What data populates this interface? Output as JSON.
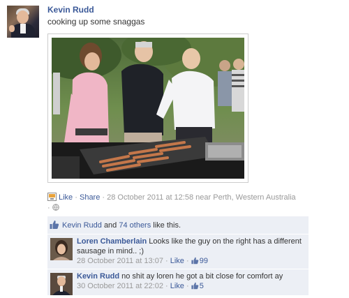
{
  "post": {
    "author": "Kevin Rudd",
    "status_text": "cooking up some snaggas",
    "photo_alt": "photo",
    "meta": {
      "like_label": "Like",
      "share_label": "Share",
      "timestamp": "28 October 2011 at 12:58",
      "location_prefix": "near",
      "location": "Perth, Western Australia",
      "separator": "·",
      "privacy_icon": "globe-icon"
    }
  },
  "likes": {
    "icon": "thumbs-up-icon",
    "first_name": "Kevin Rudd",
    "conjunction": "and",
    "others_label": "74 others",
    "suffix": "like this."
  },
  "comments": [
    {
      "author": "Loren Chamberlain",
      "text": "Looks like the guy on the right has a different sausage in mind.. ;)",
      "timestamp": "28 October 2011 at 13:07",
      "like_label": "Like",
      "like_count": "99"
    },
    {
      "author": "Kevin Rudd",
      "text": "no shit ay loren he got a bit close for comfort ay",
      "timestamp": "30 October 2011 at 22:02",
      "like_label": "Like",
      "like_count": "5"
    }
  ],
  "colors": {
    "link": "#3b5998",
    "ufi_background": "#eceff5",
    "muted": "#999999"
  }
}
